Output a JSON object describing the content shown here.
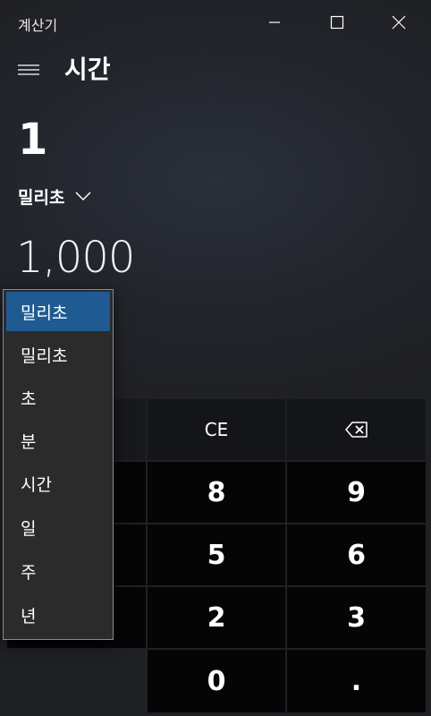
{
  "window": {
    "title": "계산기"
  },
  "header": {
    "title": "시간"
  },
  "converter": {
    "from_value": "1",
    "from_unit": "밀리초",
    "to_value": "1,000"
  },
  "dropdown": {
    "items": [
      "밀리초",
      "밀리초",
      "초",
      "분",
      "시간",
      "일",
      "주",
      "년"
    ],
    "selected_index": 0
  },
  "keypad": {
    "ce": "CE",
    "k8": "8",
    "k9": "9",
    "k5": "5",
    "k6": "6",
    "k2": "2",
    "k3": "3",
    "k0": "0",
    "dot": "."
  },
  "icons": {
    "minimize": "minimize-icon",
    "maximize": "maximize-icon",
    "close": "close-icon",
    "menu": "hamburger-icon",
    "chevron": "chevron-down-icon",
    "backspace": "backspace-icon"
  },
  "colors": {
    "accent": "#1f5b92",
    "key_bg": "#050505",
    "func_key_bg": "#141519"
  }
}
